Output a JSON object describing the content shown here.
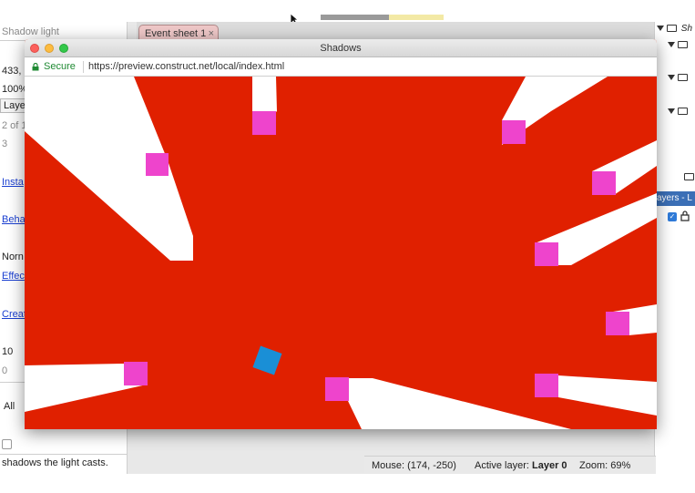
{
  "editor": {
    "left_panel": {
      "object_name": "Shadow light",
      "position_value": "433,",
      "opacity_value": "100%",
      "layer_select": "Laye",
      "instance_count": "2 of 1",
      "number_value": "3",
      "instance_variables_link": "Insta",
      "behaviors_link": "Beha",
      "blend_select": "Norn",
      "effects_link": "Effec",
      "create_link": "Creat",
      "value_ten": "10",
      "value_zero": "0",
      "all_button": "All",
      "description": "shadows the light casts."
    },
    "tab": {
      "label": "Event sheet 1",
      "close": "×"
    },
    "right_panel": {
      "tree_top_label": "Sh",
      "layers_header": "ayers - L"
    },
    "statusbar": {
      "mouse": "Mouse: (174, -250)",
      "active_layer_label": "Active layer:",
      "active_layer_value": "Layer 0",
      "zoom": "Zoom: 69%"
    }
  },
  "preview": {
    "window_title": "Shadows",
    "secure_label": "Secure",
    "url": "https://preview.construct.net/local/index.html"
  },
  "colors": {
    "background": "#e02000",
    "shadow": "#ffffff",
    "caster": "#ee44cc",
    "light": "#1a8fd6"
  }
}
